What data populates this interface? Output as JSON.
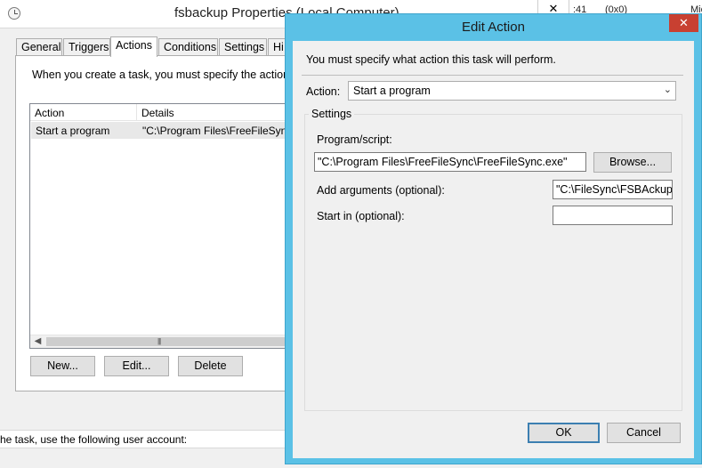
{
  "background_window": {
    "title": "fsbackup Properties (Local Computer)",
    "close_glyph": "✕",
    "tabs": [
      "General",
      "Triggers",
      "Actions",
      "Conditions",
      "Settings",
      "Hi"
    ],
    "active_tab": "Actions",
    "description": "When you create a task, you must specify the action th",
    "list_headers": [
      "Action",
      "Details"
    ],
    "rows": [
      {
        "action": "Start a program",
        "details": "\"C:\\Program Files\\FreeFileSync"
      }
    ],
    "buttons": {
      "new": "New...",
      "edit": "Edit...",
      "delete": "Delete"
    },
    "bottom_text": "he task, use the following user account:",
    "right_strip": {
      "time": ":41",
      "code": "(0x0)",
      "name": "Mic"
    }
  },
  "edit_action_dialog": {
    "title": "Edit Action",
    "close_glyph": "✕",
    "instruction": "You must specify what action this task will perform.",
    "action_label": "Action:",
    "action_value": "Start a program",
    "settings_label": "Settings",
    "program_label": "Program/script:",
    "program_value": "\"C:\\Program Files\\FreeFileSync\\FreeFileSync.exe\"",
    "browse_label": "Browse...",
    "arguments_label": "Add arguments (optional):",
    "arguments_value": "\"C:\\FileSync\\FSBAckup.f",
    "start_in_label": "Start in (optional):",
    "start_in_value": "",
    "ok_label": "OK",
    "cancel_label": "Cancel"
  },
  "colors": {
    "dialog_frame": "#5bc1e6",
    "close_button": "#c84031",
    "window_background": "#f0f0f0"
  }
}
